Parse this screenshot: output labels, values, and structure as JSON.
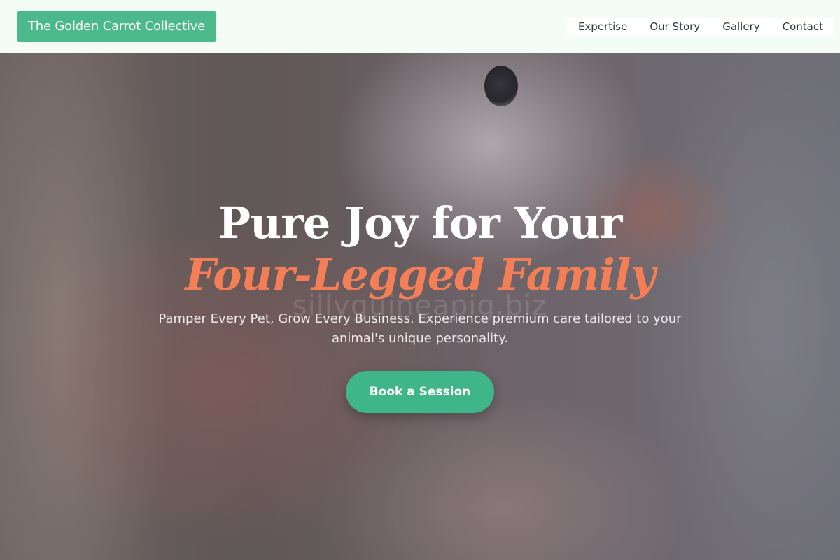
{
  "header": {
    "logo_text": "The Golden Carrot Collective",
    "nav": [
      {
        "label": "Expertise"
      },
      {
        "label": "Our Story"
      },
      {
        "label": "Gallery"
      },
      {
        "label": "Contact"
      }
    ]
  },
  "hero": {
    "title_line1": "Pure Joy for Your",
    "title_line2": "Four-Legged Family",
    "subtitle": "Pamper Every Pet, Grow Every Business. Experience premium care tailored to your animal's unique personality.",
    "cta_label": "Book a Session",
    "watermark": "sillyguineapig.biz"
  },
  "colors": {
    "brand_green": "#4cb98a",
    "cta_green": "#3fb58a",
    "accent_orange": "#f47e55",
    "header_bg": "#f3fdf6"
  }
}
